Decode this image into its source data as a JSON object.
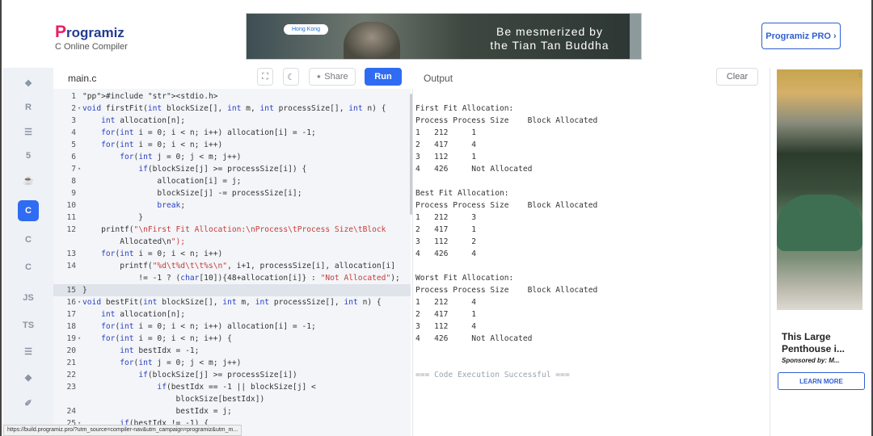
{
  "header": {
    "logo_p": "P",
    "logo_rest": "rogramiz",
    "subtitle": "C Online Compiler",
    "ad": {
      "location_tag": "Hong Kong",
      "line1": "Be mesmerized by",
      "line2": "the Tian Tan Buddha"
    },
    "pro_button": "Programiz PRO ›"
  },
  "sidebar": {
    "items": [
      {
        "name": "python",
        "glyph": "❖"
      },
      {
        "name": "r",
        "glyph": "R"
      },
      {
        "name": "sql",
        "glyph": "☰"
      },
      {
        "name": "html",
        "glyph": "5"
      },
      {
        "name": "java",
        "glyph": "☕"
      },
      {
        "name": "c",
        "glyph": "C"
      },
      {
        "name": "cpp",
        "glyph": "C"
      },
      {
        "name": "csharp",
        "glyph": "C"
      },
      {
        "name": "js",
        "glyph": "JS"
      },
      {
        "name": "ts",
        "glyph": "TS"
      },
      {
        "name": "go",
        "glyph": "☰"
      },
      {
        "name": "php",
        "glyph": "◆"
      },
      {
        "name": "swift",
        "glyph": "✐"
      }
    ]
  },
  "editor": {
    "file_tab": "main.c",
    "share_label": "Share",
    "run_label": "Run",
    "lines": [
      {
        "n": "1",
        "code": "#include <stdio.h>"
      },
      {
        "n": "2",
        "fold": "▾",
        "code": "void firstFit(int blockSize[], int m, int processSize[], int n) {"
      },
      {
        "n": "3",
        "code": "    int allocation[n];"
      },
      {
        "n": "4",
        "code": "    for(int i = 0; i < n; i++) allocation[i] = -1;"
      },
      {
        "n": "5",
        "code": "    for(int i = 0; i < n; i++)"
      },
      {
        "n": "6",
        "code": "        for(int j = 0; j < m; j++)"
      },
      {
        "n": "7",
        "fold": "▾",
        "code": "            if(blockSize[j] >= processSize[i]) {"
      },
      {
        "n": "8",
        "code": "                allocation[i] = j;"
      },
      {
        "n": "9",
        "code": "                blockSize[j] -= processSize[i];"
      },
      {
        "n": "10",
        "code": "                break;"
      },
      {
        "n": "11",
        "code": "            }"
      },
      {
        "n": "12",
        "code": "    printf(\"\\nFirst Fit Allocation:\\nProcess\\tProcess Size\\tBlock"
      },
      {
        "n": "",
        "code": "        Allocated\\n\");"
      },
      {
        "n": "13",
        "code": "    for(int i = 0; i < n; i++)"
      },
      {
        "n": "14",
        "code": "        printf(\"%d\\t%d\\t\\t%s\\n\", i+1, processSize[i], allocation[i]"
      },
      {
        "n": "",
        "code": "            != -1 ? (char[10]){48+allocation[i]} : \"Not Allocated\");"
      },
      {
        "n": "15",
        "code": "}",
        "hl": true
      },
      {
        "n": "16",
        "fold": "▾",
        "code": "void bestFit(int blockSize[], int m, int processSize[], int n) {"
      },
      {
        "n": "17",
        "code": "    int allocation[n];"
      },
      {
        "n": "18",
        "code": "    for(int i = 0; i < n; i++) allocation[i] = -1;"
      },
      {
        "n": "19",
        "fold": "▾",
        "code": "    for(int i = 0; i < n; i++) {"
      },
      {
        "n": "20",
        "code": "        int bestIdx = -1;"
      },
      {
        "n": "21",
        "code": "        for(int j = 0; j < m; j++)"
      },
      {
        "n": "22",
        "code": "            if(blockSize[j] >= processSize[i])"
      },
      {
        "n": "23",
        "code": "                if(bestIdx == -1 || blockSize[j] <"
      },
      {
        "n": "",
        "code": "                    blockSize[bestIdx])"
      },
      {
        "n": "24",
        "code": "                    bestIdx = j;"
      },
      {
        "n": "25",
        "fold": "▾",
        "code": "        if(bestIdx != -1) {"
      }
    ]
  },
  "output": {
    "title": "Output",
    "clear_label": "Clear",
    "lines": [
      "First Fit Allocation:",
      "Process Process Size    Block Allocated",
      "1   212     1",
      "2   417     4",
      "3   112     1",
      "4   426     Not Allocated",
      "",
      "Best Fit Allocation:",
      "Process Process Size    Block Allocated",
      "1   212     3",
      "2   417     1",
      "3   112     2",
      "4   426     4",
      "",
      "Worst Fit Allocation:",
      "Process Process Size    Block Allocated",
      "1   212     4",
      "2   417     1",
      "3   112     4",
      "4   426     Not Allocated",
      "",
      "",
      "=== Code Execution Successful ==="
    ]
  },
  "right_ad": {
    "title": "This Large Penthouse i...",
    "sponsor": "Sponsored by: M...",
    "cta": "LEARN MORE"
  },
  "status_url": "https://build.programiz.pro/?utm_source=compiler-nav&utm_campaign=programiz&utm_m..."
}
